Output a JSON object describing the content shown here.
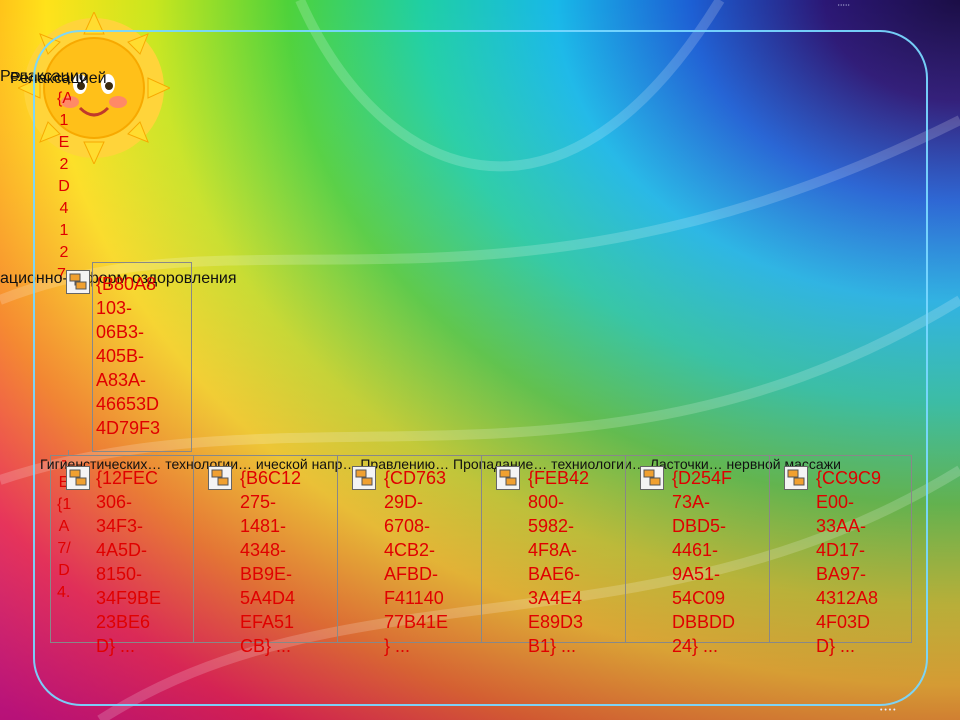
{
  "header_strip": "• • • • •",
  "footer_logo": "• • • •",
  "nodes": {
    "root_label": "Релаксацио",
    "root_code_chars": "{A1E2D4127...",
    "second_label": "Релаксацией",
    "middle_label": "ационно-... форм оздоровления",
    "middle_code": "{B80A8\n103-\n06B3-\n405B-\nA83A-\n46653D\n4D79F3",
    "left_column_code": "-E{1A7/D4...",
    "children_row_label": "Гигиенстических… технологии… ической напр… Правлению… Пропадание… техниологии… Ласточки… нервной массажи",
    "children": [
      {
        "code": "{12FEC\n306-\n34F3-\n4A5D-\n8150-\n34F9BE\n23BE6\nD} ..."
      },
      {
        "code": "{B6C12\n275-\n1481-\n4348-\nBB9E-\n5A4D4\nEFA51\nCB} ..."
      },
      {
        "code": "{CD763\n29D-\n6708-\n4CB2-\nAFBD-\nF41140\n77B41E\n} ..."
      },
      {
        "code": "{FEB42\n800-\n5982-\n4F8A-\nBAE6-\n3A4E4\nE89D3\nB1} ..."
      },
      {
        "code": "{D254F\n73A-\nDBD5-\n4461-\n9A51-\n54C09\nDBBDD\n24} ..."
      },
      {
        "code": "{CC9C9\nE00-\n33AA-\n4D17-\nBA97-\n4312A8\n4F03D\nD} ..."
      }
    ]
  }
}
